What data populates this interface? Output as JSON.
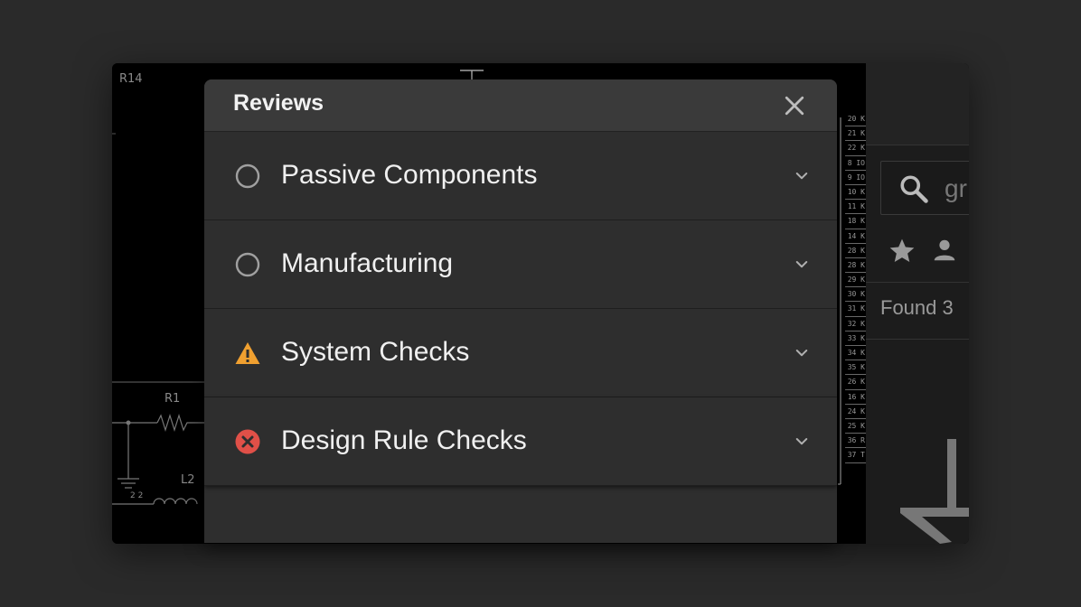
{
  "schematic": {
    "ref_r14": "R14",
    "ref_r1": "R1",
    "ref_l2": "L2",
    "pin_nums": "2 2",
    "pins": [
      "20 K",
      "21 K",
      "22 K",
      "8 IO",
      "9 IO",
      "10 K",
      "11 K",
      "18 K",
      "14 K",
      "28 K",
      "28 K",
      "29 K",
      "30 K",
      "31 K",
      "32 K",
      "33 K",
      "34 K",
      "35 K",
      "26 K",
      "16 K",
      "24 K",
      "25 K",
      "36 R",
      "37 T"
    ]
  },
  "right_panel": {
    "search_partial": "gr",
    "found_text": "Found 3"
  },
  "dialog": {
    "title": "Reviews",
    "items": [
      {
        "label": "Passive Components",
        "status": "pending"
      },
      {
        "label": "Manufacturing",
        "status": "pending"
      },
      {
        "label": "System Checks",
        "status": "warning"
      },
      {
        "label": "Design Rule Checks",
        "status": "error"
      }
    ]
  },
  "colors": {
    "warning": "#f0a030",
    "error": "#e05048",
    "pending": "#9a9a9a"
  }
}
